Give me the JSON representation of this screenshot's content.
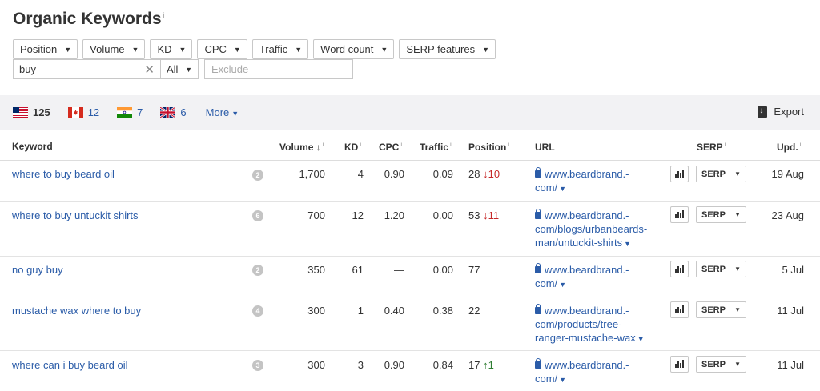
{
  "title": "Organic Keywords",
  "info_mark": "i",
  "filters": [
    "Position",
    "Volume",
    "KD",
    "CPC",
    "Traffic",
    "Word count",
    "SERP features"
  ],
  "search": {
    "value": "buy",
    "mode": "All",
    "exclude_placeholder": "Exclude"
  },
  "countries": [
    {
      "code": "US",
      "count": "125",
      "active": true
    },
    {
      "code": "CA",
      "count": "12"
    },
    {
      "code": "IN",
      "count": "7"
    },
    {
      "code": "GB",
      "count": "6"
    }
  ],
  "more_label": "More",
  "export_label": "Export",
  "columns": {
    "keyword": "Keyword",
    "volume": "Volume",
    "kd": "KD",
    "cpc": "CPC",
    "traffic": "Traffic",
    "position": "Position",
    "url": "URL",
    "serp": "SERP",
    "upd": "Upd."
  },
  "rows": [
    {
      "keyword": "where to buy beard oil",
      "badge": "2",
      "volume": "1,700",
      "kd": "4",
      "cpc": "0.90",
      "traffic": "0.09",
      "position": "28",
      "change": "10",
      "dir": "down",
      "url_lines": [
        "www.beardbrand.-",
        "com/"
      ],
      "serp": "SERP",
      "upd": "19 Aug"
    },
    {
      "keyword": "where to buy untuckit shirts",
      "badge": "6",
      "volume": "700",
      "kd": "12",
      "cpc": "1.20",
      "traffic": "0.00",
      "position": "53",
      "change": "11",
      "dir": "down",
      "url_lines": [
        "www.beardbrand.-",
        "com/blogs/urbanbeards-",
        "man/untuckit-shirts"
      ],
      "serp": "SERP",
      "upd": "23 Aug"
    },
    {
      "keyword": "no guy buy",
      "badge": "2",
      "volume": "350",
      "kd": "61",
      "cpc": "—",
      "traffic": "0.00",
      "position": "77",
      "change": "",
      "dir": "",
      "url_lines": [
        "www.beardbrand.-",
        "com/"
      ],
      "serp": "SERP",
      "upd": "5 Jul"
    },
    {
      "keyword": "mustache wax where to buy",
      "badge": "4",
      "volume": "300",
      "kd": "1",
      "cpc": "0.40",
      "traffic": "0.38",
      "position": "22",
      "change": "",
      "dir": "",
      "url_lines": [
        "www.beardbrand.-",
        "com/products/tree-",
        "ranger-mustache-wax"
      ],
      "serp": "SERP",
      "upd": "11 Jul"
    },
    {
      "keyword": "where can i buy beard oil",
      "badge": "3",
      "volume": "300",
      "kd": "3",
      "cpc": "0.90",
      "traffic": "0.84",
      "position": "17",
      "change": "1",
      "dir": "up",
      "url_lines": [
        "www.beardbrand.-",
        "com/"
      ],
      "serp": "SERP",
      "upd": "11 Jul"
    }
  ]
}
